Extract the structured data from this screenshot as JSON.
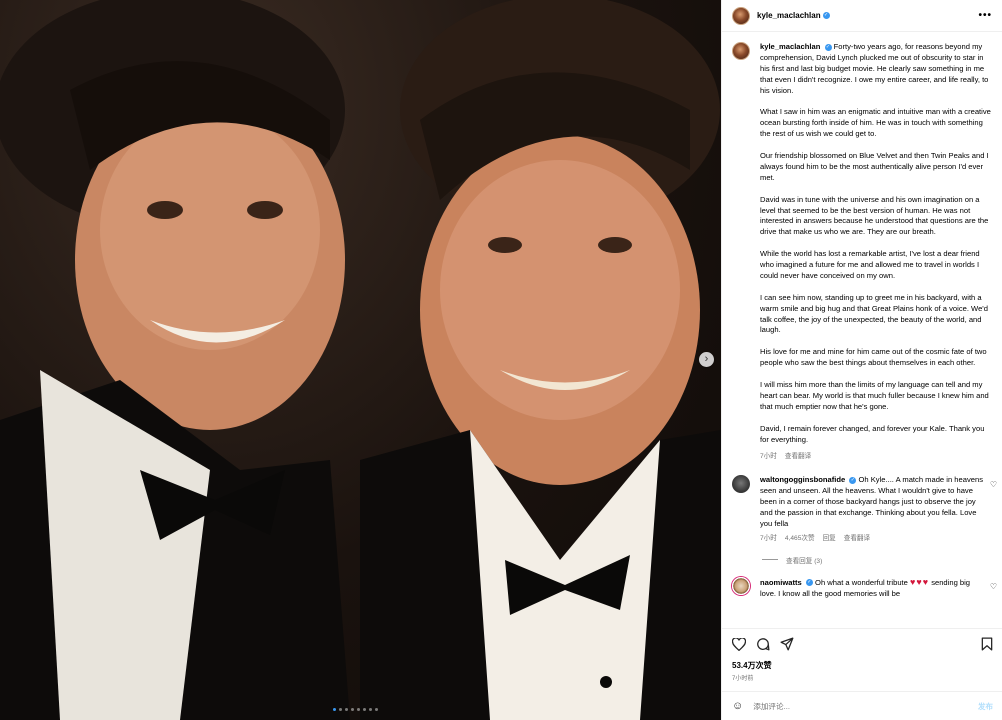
{
  "post": {
    "username": "kyle_maclachlan",
    "more_icon": "more-horizontal-icon",
    "carousel": {
      "slide_count": 8,
      "active_index": 0,
      "next_icon": "chevron-right-icon"
    }
  },
  "caption": {
    "username": "kyle_maclachlan",
    "paragraphs": [
      "Forty-two years ago, for reasons beyond my comprehension, David Lynch plucked me out of obscurity to star in his first and last big budget movie. He clearly saw something in me that even I didn't recognize. I owe my entire career, and life really, to his vision.",
      "What I saw in him was an enigmatic and intuitive man with a creative ocean bursting forth inside of him. He was in touch with something the rest of us wish we could get to.",
      "Our friendship blossomed on Blue Velvet and then Twin Peaks and I always found him to be the most authentically alive person I'd ever met.",
      "David was in tune with the universe and his own imagination on a level that seemed to be the best version of human. He was not interested in answers because he understood that questions are the drive that make us who we are. They are our breath.",
      "While the world has lost a remarkable artist, I've lost a dear friend who imagined a future for me and allowed me to travel in worlds I could never have conceived on my own.",
      "I can see him now, standing up to greet me in his backyard, with a warm smile and big hug and that Great Plains honk of a voice. We'd talk coffee, the joy of the unexpected, the beauty of the world, and laugh.",
      "His love for me and mine for him came out of the cosmic fate of two people who saw the best things about themselves in each other.",
      "I will miss him more than the limits of my language can tell and my heart can bear. My world is that much fuller because I knew him and that much emptier now that he's gone.",
      "David, I remain forever changed, and forever your Kale. Thank you for everything."
    ],
    "time": "7小时",
    "translate": "查看翻译"
  },
  "comments": [
    {
      "username": "waltongogginsbonafide",
      "text": "Oh Kyle.... A match made in heavens seen and unseen. All the heavens. What I wouldn't give to have been in a corner of those backyard hangs just to observe the joy and the passion in that exchange. Thinking about you fella. Love you fella",
      "time": "7小时",
      "likes": "4,465次赞",
      "reply": "回复",
      "translate": "查看翻译",
      "view_replies": "查看回复 (3)"
    },
    {
      "username": "naomiwatts",
      "text": "Oh what a wonderful tribute",
      "hearts": "♥♥♥",
      "text2": "sending big love. I know all the good memories will be"
    }
  ],
  "actions": {
    "like_icon": "heart-icon",
    "comment_icon": "comment-icon",
    "share_icon": "share-icon",
    "save_icon": "bookmark-icon",
    "likes": "53.4万次赞",
    "time": "7小时前"
  },
  "compose": {
    "emoji_icon": "emoji-icon",
    "placeholder": "添加评论...",
    "post_label": "发布"
  },
  "colors": {
    "accent": "#3897f0",
    "post_disabled": "#b2dffc",
    "heart": "#d3163b"
  }
}
